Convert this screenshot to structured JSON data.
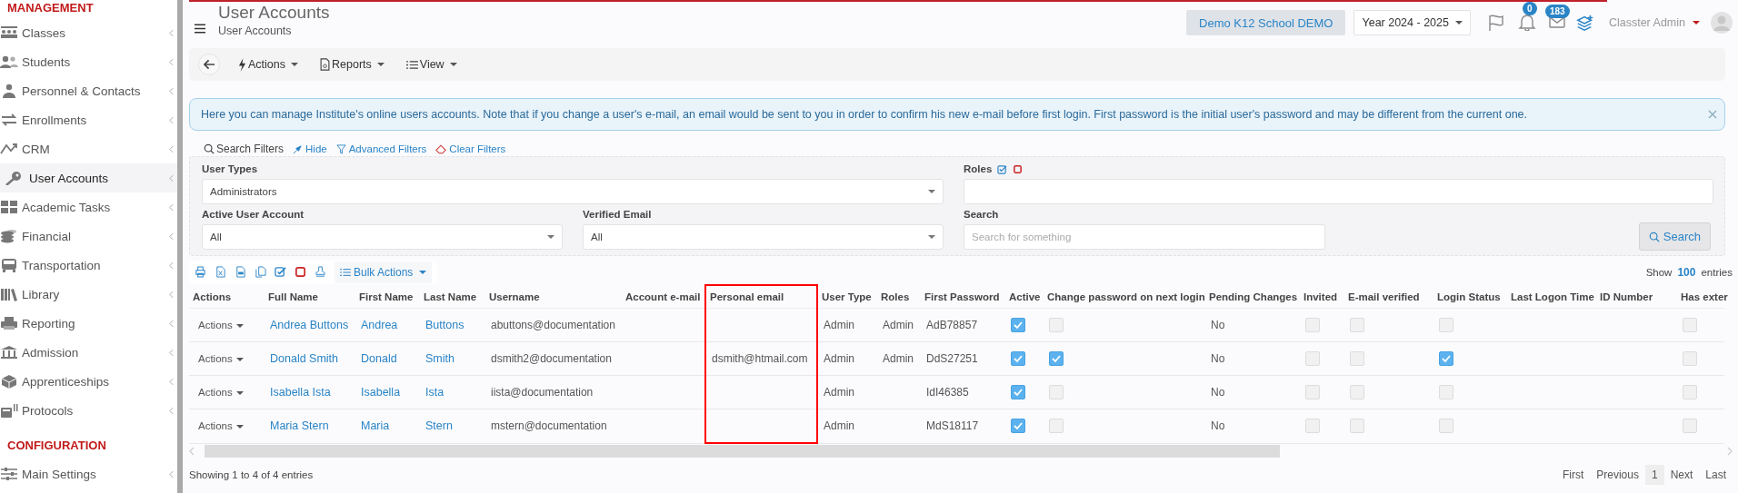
{
  "sidebar": {
    "sections": [
      {
        "heading": "MANAGEMENT",
        "items": [
          {
            "label": "Classes",
            "selected": false
          },
          {
            "label": "Students",
            "selected": false
          },
          {
            "label": "Personnel & Contacts",
            "selected": false
          },
          {
            "label": "Enrollments",
            "selected": false
          },
          {
            "label": "CRM",
            "selected": false
          },
          {
            "label": "User Accounts",
            "selected": true
          },
          {
            "label": "Academic Tasks",
            "selected": false
          },
          {
            "label": "Financial",
            "selected": false
          },
          {
            "label": "Transportation",
            "selected": false
          },
          {
            "label": "Library",
            "selected": false
          },
          {
            "label": "Reporting",
            "selected": false
          },
          {
            "label": "Admission",
            "selected": false
          },
          {
            "label": "Apprenticeships",
            "selected": false
          },
          {
            "label": "Protocols",
            "selected": false
          }
        ]
      },
      {
        "heading": "CONFIGURATION",
        "items": [
          {
            "label": "Main Settings",
            "selected": false
          }
        ]
      }
    ]
  },
  "header": {
    "title": "User Accounts",
    "breadcrumb": "User Accounts",
    "school": "Demo K12 School DEMO",
    "year": "Year 2024 - 2025",
    "notifications": "0",
    "messages": "183",
    "user": "Classter Admin"
  },
  "toolbar": [
    "Actions",
    "Reports",
    "View"
  ],
  "alert": "Here you can manage Institute's online users accounts. Note that if you change a user's e-mail, an email would be sent to you in order to confirm his new e-mail before first login. First password is the initial user's password and may be different from the current one.",
  "filters": {
    "links": [
      "Search Filters",
      "Hide",
      "Advanced Filters",
      "Clear Filters"
    ],
    "fields": [
      {
        "label": "User Types",
        "value": "Administrators",
        "kind": "select"
      },
      {
        "label": "Roles",
        "kind": "roles"
      },
      {
        "label": "Active User Account",
        "value": "All",
        "kind": "select"
      },
      {
        "label": "Verified Email",
        "value": "All",
        "kind": "select"
      },
      {
        "label": "Search",
        "placeholder": "Search for something",
        "kind": "text"
      }
    ],
    "search_button": "Search"
  },
  "table": {
    "bulk_actions": "Bulk Actions",
    "show": "Show",
    "page_size": "100",
    "entries": "entries",
    "columns": [
      {
        "title": "Actions",
        "kind": "actions",
        "highlighted": false
      },
      {
        "title": "Full Name",
        "kind": "link",
        "highlighted": false
      },
      {
        "title": "First Name",
        "kind": "link",
        "highlighted": false
      },
      {
        "title": "Last Name",
        "kind": "link",
        "highlighted": false
      },
      {
        "title": "Username",
        "kind": "text",
        "highlighted": false
      },
      {
        "title": "Account e-mail",
        "highlighted": false
      },
      {
        "title": "Personal email",
        "kind": "text",
        "highlighted": true
      },
      {
        "title": "User Type",
        "kind": "text",
        "highlighted": false
      },
      {
        "title": "Roles",
        "kind": "text",
        "highlighted": false
      },
      {
        "title": "First Password",
        "kind": "text",
        "highlighted": false
      },
      {
        "title": "Active",
        "kind": "check",
        "highlighted": false
      },
      {
        "title": "Change password on next login",
        "kind": "check",
        "highlighted": false
      },
      {
        "title": "Pending Changes",
        "kind": "text",
        "highlighted": false
      },
      {
        "title": "Invited",
        "kind": "check",
        "highlighted": false
      },
      {
        "title": "E-mail verified",
        "kind": "check",
        "highlighted": false
      },
      {
        "title": "Login Status",
        "kind": "check",
        "highlighted": false
      },
      {
        "title": "Last Logon Time",
        "highlighted": false
      },
      {
        "title": "ID Number",
        "highlighted": false
      },
      {
        "title": "Has exter",
        "kind": "check",
        "highlighted": false
      }
    ],
    "rows": [
      {
        "actions": "Actions",
        "full_name": "Andrea Buttons",
        "first_name": "Andrea",
        "last_name": "Buttons",
        "username": "abuttons@documentation",
        "user_type": "Admin",
        "roles": "Admin",
        "first_password": "AdB78857",
        "active": true,
        "change_password": false,
        "pending_changes": "No",
        "invited": false,
        "email_verified": false,
        "login_status": false,
        "has_external": false
      },
      {
        "actions": "Actions",
        "full_name": "Donald Smith",
        "first_name": "Donald",
        "last_name": "Smith",
        "username": "dsmith2@documentation",
        "personal_email": "dsmith@htmail.com",
        "user_type": "Admin",
        "roles": "Admin",
        "first_password": "DdS27251",
        "active": true,
        "change_password": true,
        "pending_changes": "No",
        "invited": false,
        "email_verified": false,
        "login_status": true,
        "has_external": false
      },
      {
        "actions": "Actions",
        "full_name": "Isabella Ista",
        "first_name": "Isabella",
        "last_name": "Ista",
        "username": "iista@documentation",
        "user_type": "Admin",
        "first_password": "IdI46385",
        "active": true,
        "change_password": false,
        "pending_changes": "No",
        "invited": false,
        "email_verified": false,
        "login_status": false,
        "has_external": false
      },
      {
        "actions": "Actions",
        "full_name": "Maria Stern",
        "first_name": "Maria",
        "last_name": "Stern",
        "username": "mstern@documentation",
        "user_type": "Admin",
        "first_password": "MdS18117",
        "active": true,
        "change_password": false,
        "pending_changes": "No",
        "invited": false,
        "email_verified": false,
        "login_status": false,
        "has_external": false
      }
    ],
    "summary": "Showing 1 to 4 of 4 entries",
    "pagination": [
      {
        "label": "First",
        "selected": false
      },
      {
        "label": "Previous",
        "selected": false
      },
      {
        "label": "1",
        "selected": true
      },
      {
        "label": "Next",
        "selected": false
      },
      {
        "label": "Last",
        "selected": false
      }
    ]
  }
}
